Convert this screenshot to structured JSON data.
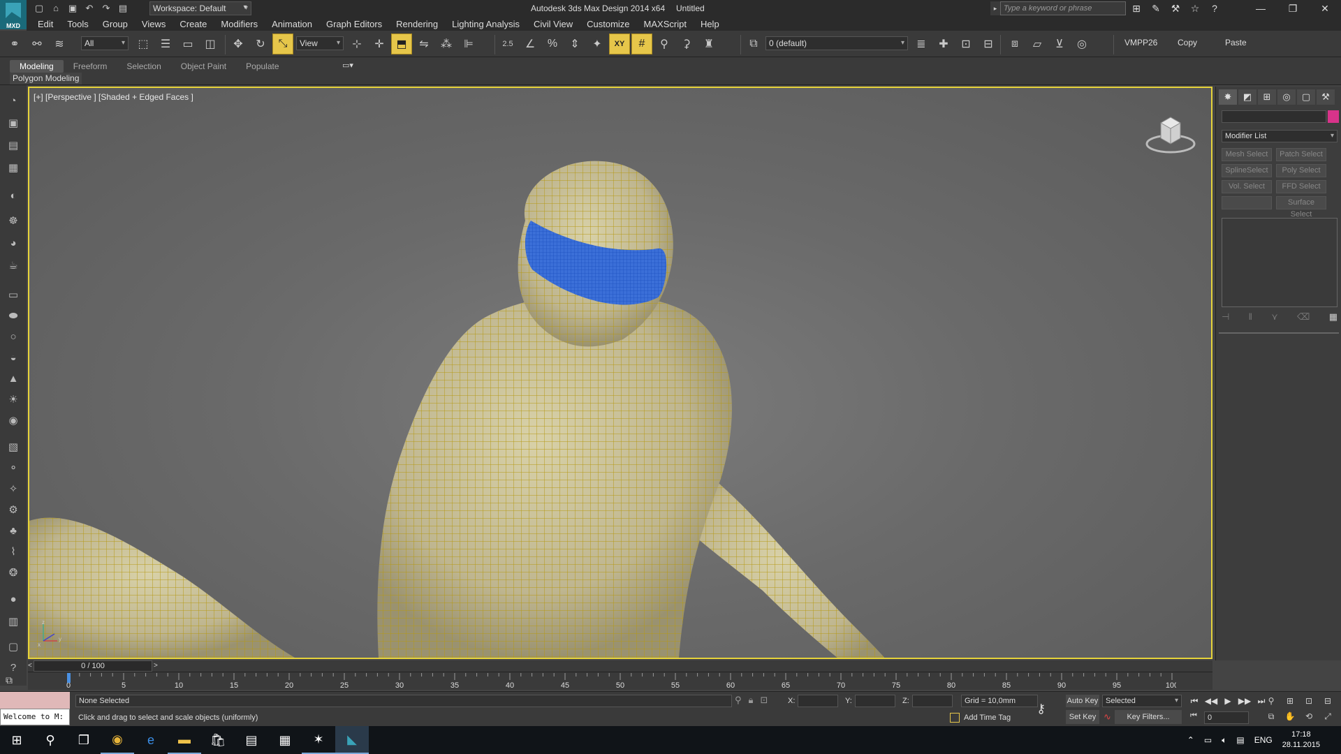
{
  "title_bar": {
    "logo_text": "MXD",
    "workspace": "Workspace: Default",
    "app_title": "Autodesk 3ds Max Design 2014 x64",
    "doc_name": "Untitled",
    "search_placeholder": "Type a keyword or phrase",
    "title_icons": [
      "binoculars-icon",
      "key-icon",
      "exchange-icon",
      "star-icon",
      "help-icon"
    ],
    "window_controls": [
      "minimize",
      "restore",
      "close"
    ]
  },
  "menu": [
    "Edit",
    "Tools",
    "Group",
    "Views",
    "Create",
    "Modifiers",
    "Animation",
    "Graph Editors",
    "Rendering",
    "Lighting Analysis",
    "Civil View",
    "Customize",
    "MAXScript",
    "Help"
  ],
  "toolbar": {
    "selection_filter": "All",
    "ref_coord": "View",
    "snap_label": "2.5",
    "layer_dropdown": "0 (default)",
    "vmpp": "VMPP26",
    "copy": "Copy",
    "paste": "Paste"
  },
  "ribbon": {
    "tabs": [
      "Modeling",
      "Freeform",
      "Selection",
      "Object Paint",
      "Populate"
    ],
    "active_tab": "Modeling",
    "panel_label": "Polygon Modeling"
  },
  "viewport": {
    "label": "[+] [Perspective ] [Shaded + Edged Faces ]",
    "border_color": "#e6d33a",
    "mesh_color": "#d2c88a",
    "wire_color": "#b79a1a",
    "selection_color": "#3b6fd8",
    "axis_labels": [
      "x",
      "y",
      "z"
    ]
  },
  "command_panel": {
    "modifier_list": "Modifier List",
    "swatch_color": "#d8338a",
    "buttons": [
      "Mesh Select",
      "Patch Select",
      "SplineSelect",
      "Poly Select",
      "Vol. Select",
      "FFD Select",
      "",
      "Surface Select"
    ]
  },
  "timeline": {
    "frame_label": "0 / 100",
    "ticks": [
      "0",
      "5",
      "10",
      "15",
      "20",
      "25",
      "30",
      "35",
      "40",
      "45",
      "50",
      "55",
      "60",
      "65",
      "70",
      "75",
      "80",
      "85",
      "90",
      "95",
      "100"
    ]
  },
  "status": {
    "maxscript_text": "Welcome to M:",
    "selection": "None Selected",
    "prompt": "Click and drag to select and scale objects (uniformly)",
    "x_label": "X:",
    "y_label": "Y:",
    "z_label": "Z:",
    "grid": "Grid = 10,0mm",
    "add_time_tag": "Add Time Tag",
    "auto_key": "Auto Key",
    "set_key": "Set Key",
    "key_mode": "Selected",
    "key_filters": "Key Filters...",
    "current_frame": "0"
  },
  "taskbar": {
    "lang": "ENG",
    "time": "17:18",
    "date": "28.11.2015"
  }
}
